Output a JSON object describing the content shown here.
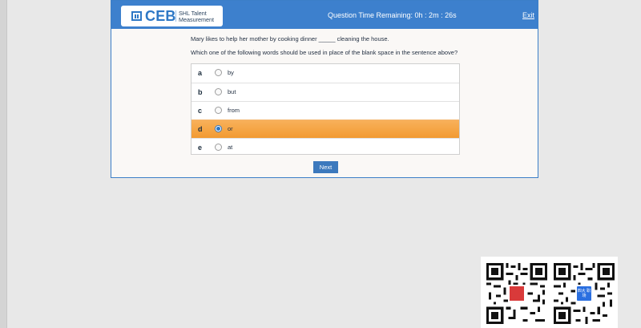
{
  "header": {
    "logo_text": "CEB",
    "logo_sub": "SHL Talent Measurement",
    "timer": "Question Time Remaining: 0h : 2m : 26s",
    "exit_label": "Exit"
  },
  "question": {
    "text": "Mary likes to help her mother by cooking dinner _____ cleaning the house.",
    "instruction": "Which one of the following words should be used in place of the blank space in the sentence above?"
  },
  "options": [
    {
      "letter": "a",
      "text": "by",
      "selected": false
    },
    {
      "letter": "b",
      "text": "but",
      "selected": false
    },
    {
      "letter": "c",
      "text": "from",
      "selected": false
    },
    {
      "letter": "d",
      "text": "or",
      "selected": true
    },
    {
      "letter": "e",
      "text": "at",
      "selected": false
    }
  ],
  "next_label": "Next",
  "qr_codes": {
    "left_center_text": "",
    "right_center_text": "四大\n职场"
  },
  "colors": {
    "header": "#3d80cd",
    "selected_option": "#f29a31",
    "button": "#3c79bd"
  }
}
